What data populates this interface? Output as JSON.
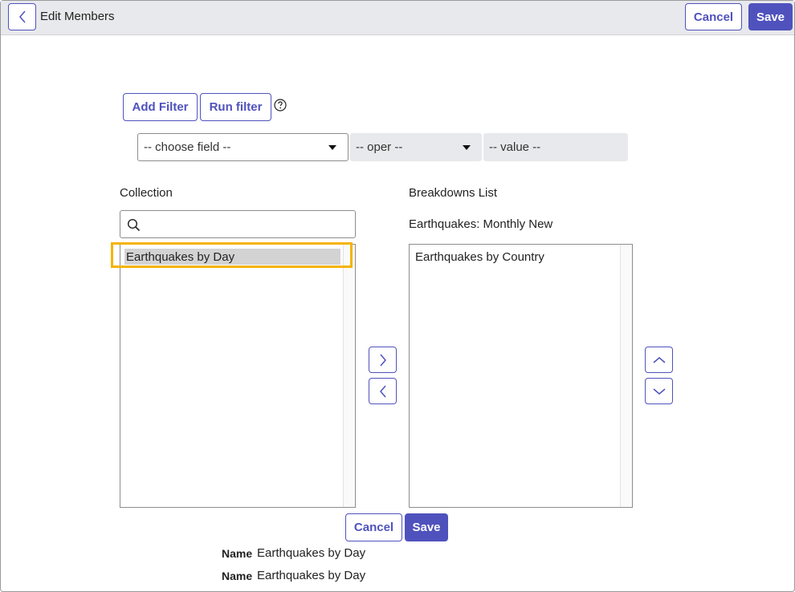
{
  "header": {
    "title": "Edit Members",
    "cancel_label": "Cancel",
    "save_label": "Save"
  },
  "filter": {
    "add_filter_label": "Add Filter",
    "run_filter_label": "Run filter",
    "field_select": "-- choose field --",
    "oper_select": "-- oper --",
    "value_placeholder": "-- value --"
  },
  "collection": {
    "label": "Collection",
    "search_value": "",
    "items": [
      "Earthquakes by Day"
    ],
    "selected_index": 0
  },
  "breakdowns": {
    "label": "Breakdowns List",
    "subtitle": "Earthquakes: Monthly New",
    "items": [
      "Earthquakes by Country"
    ]
  },
  "footer": {
    "cancel_label": "Cancel",
    "save_label": "Save",
    "fields": [
      {
        "label": "Name",
        "value": "Earthquakes by Day"
      },
      {
        "label": "Name",
        "value": "Earthquakes by Day"
      }
    ]
  },
  "colors": {
    "accent": "#4f52bd",
    "highlight": "#f5b301",
    "selected_row": "#d3d3d3",
    "header_bg": "#e8e9ec"
  },
  "icons": {
    "back": "chevron-left-icon",
    "help": "question-circle-icon",
    "search": "search-icon",
    "add": "chevron-right-icon",
    "remove": "chevron-left-icon",
    "move_up": "chevron-up-icon",
    "move_down": "chevron-down-icon"
  }
}
